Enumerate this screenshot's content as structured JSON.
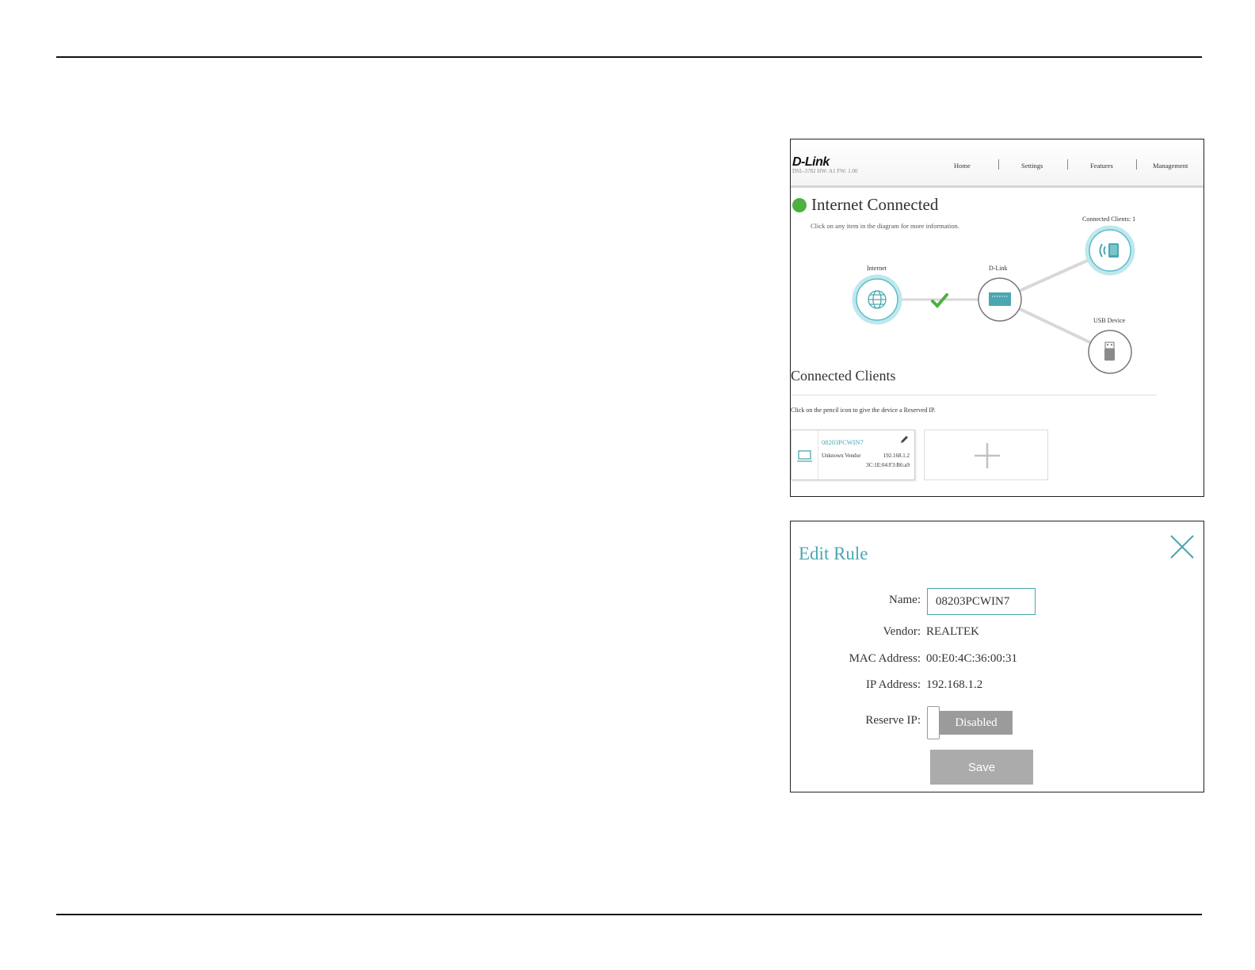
{
  "router_ui": {
    "logo": "D-Link",
    "subtitle": "DSL-3782  HW: A1  FW: 1.00",
    "nav": [
      "Home",
      "Settings",
      "Features",
      "Management"
    ],
    "status_title": "Internet Connected",
    "status_hint": "Click on any item in the diagram for more information.",
    "diagram": {
      "internet_label": "Internet",
      "router_label": "D-Link",
      "clients_label": "Connected Clients: 1",
      "usb_label": "USB Device"
    },
    "clients_section": {
      "title": "Connected Clients",
      "hint": "Click on the pencil icon to give the device a Reserved IP.",
      "card": {
        "name": "08203PCWIN7",
        "vendor": "Unknown Vendor",
        "ip": "192.168.1.2",
        "mac": "3C:1E:04:F3:B6:a9"
      }
    }
  },
  "edit_rule": {
    "title": "Edit Rule",
    "name_label": "Name:",
    "name_value": "08203PCWIN7",
    "vendor_label": "Vendor:",
    "vendor_value": "REALTEK",
    "mac_label": "MAC Address:",
    "mac_value": "00:E0:4C:36:00:31",
    "ip_label": "IP Address:",
    "ip_value": "192.168.1.2",
    "reserve_label": "Reserve IP:",
    "reserve_state": "Disabled",
    "save_label": "Save"
  },
  "colors": {
    "accent": "#4aa7b0",
    "connected_green": "#4db140",
    "disabled_gray": "#9b9b9b"
  }
}
